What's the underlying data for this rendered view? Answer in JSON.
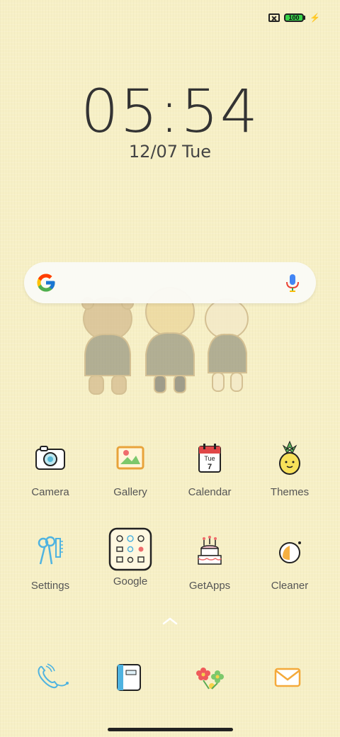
{
  "status_bar": {
    "battery_level": "100",
    "icons": [
      "no-sim-icon",
      "battery-icon",
      "charging-icon"
    ]
  },
  "clock": {
    "time": "05:54",
    "date": "12/07",
    "day": "Tue"
  },
  "search_bar": {
    "icons": [
      "google-logo-icon",
      "microphone-icon"
    ]
  },
  "apps": [
    {
      "label": "Camera",
      "icon": "camera-icon"
    },
    {
      "label": "Gallery",
      "icon": "gallery-icon"
    },
    {
      "label": "Calendar",
      "icon": "calendar-icon",
      "calendar_day": "Tue",
      "calendar_date": "7"
    },
    {
      "label": "Themes",
      "icon": "pineapple-icon"
    },
    {
      "label": "Settings",
      "icon": "scissors-comb-icon"
    },
    {
      "label": "Google",
      "icon": "folder-icon"
    },
    {
      "label": "GetApps",
      "icon": "cake-icon"
    },
    {
      "label": "Cleaner",
      "icon": "cleaner-icon"
    }
  ],
  "dock": [
    {
      "icon": "phone-icon"
    },
    {
      "icon": "notes-icon"
    },
    {
      "icon": "flowers-icon"
    },
    {
      "icon": "mail-icon"
    }
  ],
  "colors": {
    "wallpaper": "#f7f0c6",
    "battery_fill": "#39d34a",
    "label_text": "#555555"
  }
}
